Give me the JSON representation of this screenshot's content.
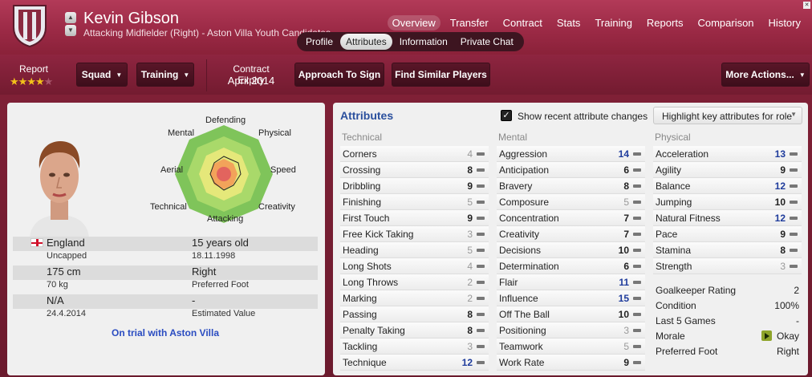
{
  "header": {
    "player_name": "Kevin Gibson",
    "subtitle": "Attacking Midfielder (Right) - Aston Villa Youth Candidates",
    "nav": [
      "Overview",
      "Transfer",
      "Contract",
      "Stats",
      "Training",
      "Reports",
      "Comparison",
      "History"
    ],
    "active_nav": "Overview",
    "subtabs": [
      "Profile",
      "Attributes",
      "Information",
      "Private Chat"
    ],
    "active_subtab": "Attributes"
  },
  "toolbar": {
    "report_label": "Report",
    "report_stars": 3.5,
    "report_stars_max": 5,
    "squad_label": "Squad",
    "training_label": "Training",
    "contract_expiry_label": "Contract Expiry",
    "contract_expiry_value": "April 2014",
    "approach_label": "Approach To Sign",
    "similar_label": "Find Similar Players",
    "more_actions_label": "More Actions..."
  },
  "profile": {
    "radar_labels": {
      "defending": "Defending",
      "physical": "Physical",
      "speed": "Speed",
      "creativity": "Creativity",
      "attacking": "Attacking",
      "technical": "Technical",
      "aerial": "Aerial",
      "mental": "Mental"
    },
    "nationality": "England",
    "age": "15 years old",
    "caps": "Uncapped",
    "dob": "18.11.1998",
    "height": "175 cm",
    "foot": "Right",
    "weight": "70 kg",
    "foot_label": "Preferred Foot",
    "value": "N/A",
    "value_misc": "-",
    "date": "24.4.2014",
    "value_label": "Estimated Value",
    "trial_text": "On trial with Aston Villa"
  },
  "attributes": {
    "title": "Attributes",
    "show_changes_label": "Show recent attribute changes",
    "show_changes_checked": true,
    "highlight_label": "Highlight key attributes for role",
    "technical_head": "Technical",
    "mental_head": "Mental",
    "physical_head": "Physical",
    "technical": [
      {
        "name": "Corners",
        "value": "4"
      },
      {
        "name": "Crossing",
        "value": "8"
      },
      {
        "name": "Dribbling",
        "value": "9"
      },
      {
        "name": "Finishing",
        "value": "5"
      },
      {
        "name": "First Touch",
        "value": "9"
      },
      {
        "name": "Free Kick Taking",
        "value": "3"
      },
      {
        "name": "Heading",
        "value": "5"
      },
      {
        "name": "Long Shots",
        "value": "4"
      },
      {
        "name": "Long Throws",
        "value": "2"
      },
      {
        "name": "Marking",
        "value": "2"
      },
      {
        "name": "Passing",
        "value": "8"
      },
      {
        "name": "Penalty Taking",
        "value": "8"
      },
      {
        "name": "Tackling",
        "value": "3"
      },
      {
        "name": "Technique",
        "value": "12"
      }
    ],
    "mental": [
      {
        "name": "Aggression",
        "value": "14"
      },
      {
        "name": "Anticipation",
        "value": "6"
      },
      {
        "name": "Bravery",
        "value": "8"
      },
      {
        "name": "Composure",
        "value": "5"
      },
      {
        "name": "Concentration",
        "value": "7"
      },
      {
        "name": "Creativity",
        "value": "7"
      },
      {
        "name": "Decisions",
        "value": "10"
      },
      {
        "name": "Determination",
        "value": "6"
      },
      {
        "name": "Flair",
        "value": "11"
      },
      {
        "name": "Influence",
        "value": "15"
      },
      {
        "name": "Off The Ball",
        "value": "10"
      },
      {
        "name": "Positioning",
        "value": "3"
      },
      {
        "name": "Teamwork",
        "value": "5"
      },
      {
        "name": "Work Rate",
        "value": "9"
      }
    ],
    "physical": [
      {
        "name": "Acceleration",
        "value": "13"
      },
      {
        "name": "Agility",
        "value": "9"
      },
      {
        "name": "Balance",
        "value": "12"
      },
      {
        "name": "Jumping",
        "value": "10"
      },
      {
        "name": "Natural Fitness",
        "value": "12"
      },
      {
        "name": "Pace",
        "value": "9"
      },
      {
        "name": "Stamina",
        "value": "8"
      },
      {
        "name": "Strength",
        "value": "3"
      }
    ],
    "status": [
      {
        "name": "Goalkeeper Rating",
        "value": "2"
      },
      {
        "name": "Condition",
        "value": "100%"
      },
      {
        "name": "Last 5 Games",
        "value": "-"
      },
      {
        "name": "Morale",
        "value": "Okay"
      },
      {
        "name": "Preferred Foot",
        "value": "Right"
      }
    ]
  }
}
